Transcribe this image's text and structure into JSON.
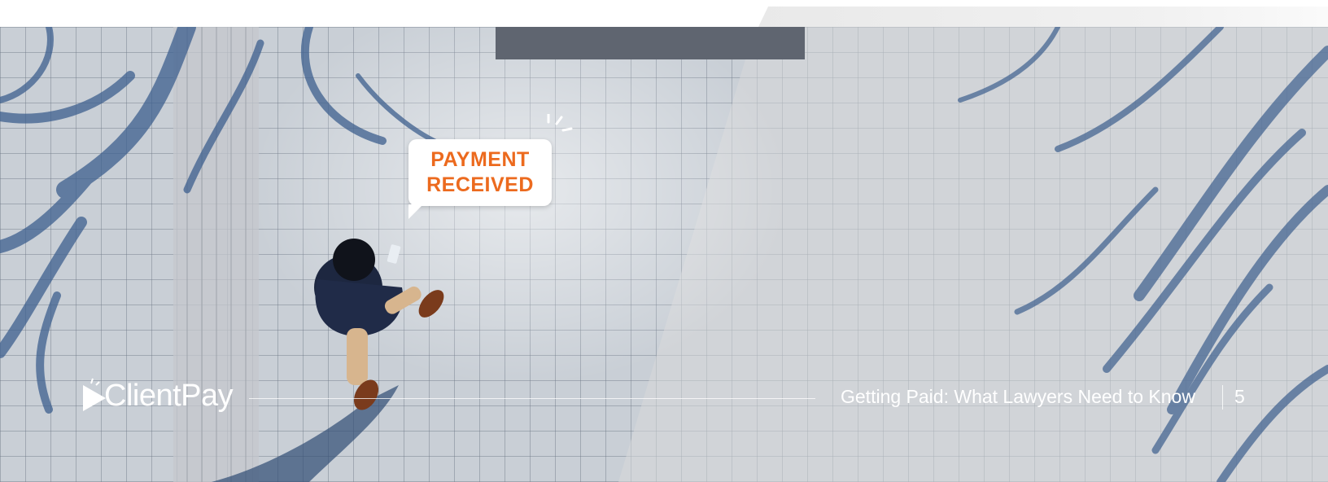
{
  "bubble": {
    "line1": "PAYMENT",
    "line2": "RECEIVED"
  },
  "brand": {
    "name": "ClientPay",
    "icon": "play-logo-icon"
  },
  "footer": {
    "title": "Getting Paid: What Lawyers Need to Know",
    "page": "5"
  },
  "colors": {
    "accent": "#ec6a1e",
    "text_on_photo": "#ffffff",
    "tile_shadow": "#3d5f8e"
  }
}
